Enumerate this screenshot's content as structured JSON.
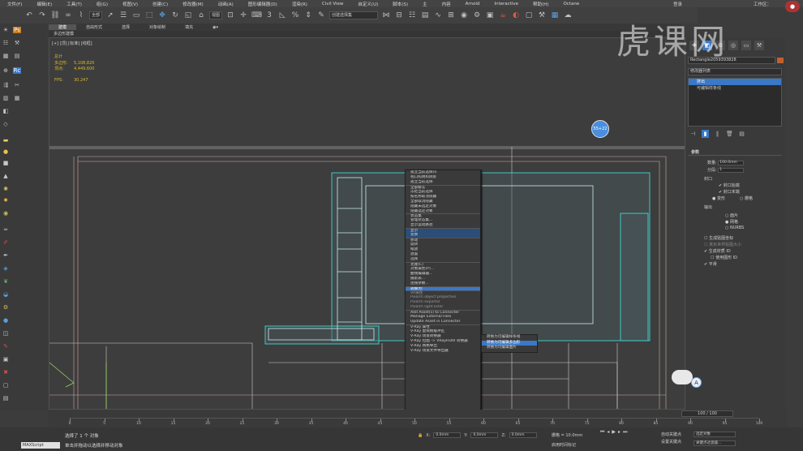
{
  "menu": [
    "文件(F)",
    "编辑(E)",
    "工具(T)",
    "组(G)",
    "视图(V)",
    "创建(C)",
    "修改器(M)",
    "动画(A)",
    "图形编辑器(D)",
    "渲染(R)",
    "Civil View",
    "自定义(U)",
    "脚本(S)",
    "主",
    "内容",
    "Arnold",
    "Interactive",
    "帮助(H)",
    "Octane"
  ],
  "login": "登录",
  "workspace": "工作区：",
  "toolbar": {
    "filter_select": "全部",
    "view_select": "视图",
    "selset_select": "创建选择集"
  },
  "ribbon": {
    "tabs": [
      "建模",
      "自由形式",
      "选择",
      "对象绘制",
      "填充"
    ],
    "sub": "多边形建模"
  },
  "viewport": {
    "label": "[+] [顶] [标准] [线框]",
    "stats": {
      "total_label": "总计",
      "poly_label": "多边形:",
      "poly_value": "5,108,820",
      "vert_label": "顶点:",
      "vert_value": "4,449,600",
      "fps_label": "FPS:",
      "fps_value": "30.247"
    },
    "badge": "55+22"
  },
  "context_menu": {
    "items": [
      "孤立当前选择(I)",
      "视口照明和阴影",
      "孤立当前选择",
      "全部解冻",
      "冻结当前选择",
      "按名称取消隐藏",
      "全部取消隐藏",
      "隐藏未选定对象",
      "隐藏选定对象",
      "状态集",
      "管理状态集...",
      "显示运动路径",
      "显示",
      "变换",
      "移动",
      "旋转",
      "缩放",
      "放置",
      "选择",
      "克隆(C)",
      "对象属性(P)...",
      "曲线编辑器...",
      "摄影表...",
      "连线参数...",
      "转换为:",
      "VR属性",
      "Pixarm object properties",
      "Pixarm exporter",
      "Pixarm light lister",
      "Add Asset(s) to Connecter",
      "Manage External Files",
      "Update Asset in Connecter",
      "V-Ray 属性",
      "V-Ray 虚拟帧缓冲区",
      "V-Ray 场景转换器",
      "V-Ray 位图 -> VRayHDRI 转换器",
      "V-Ray 网格导出",
      "V-Ray 场景文件导出器"
    ],
    "right_labels": [
      "显示",
      "变换"
    ],
    "selected": "转换为:"
  },
  "submenu": {
    "items": [
      "转换为可编辑样条线",
      "转换为可编辑多边形",
      "转换为可编辑面片"
    ],
    "selected": "转换为可编辑多边形"
  },
  "command_panel": {
    "object_name": "Rectangle2059393828",
    "object_color": "#c06030",
    "modifier_list": "修改器列表",
    "stack": [
      "挤出",
      "可编辑样条线"
    ],
    "stack_selected": "挤出",
    "params": {
      "title": "参数",
      "amount_label": "数量:",
      "amount_value": "100.0mm",
      "segments_label": "分段:",
      "segments_value": "1",
      "capping_label": "封口",
      "cap_start": "封口始端",
      "cap_end": "封口末端",
      "morph": "变形",
      "grid": "栅格",
      "output_label": "输出",
      "patch": "面片",
      "mesh": "网格",
      "nurbs": "NURBS",
      "gen_map": "生成贴图坐标",
      "real_world": "真实世界贴图大小",
      "gen_mat": "生成材质 ID",
      "use_shape": "使用图形 ID",
      "smooth": "平滑"
    }
  },
  "timeline": {
    "slider": "100 / 100",
    "ticks": [
      "0",
      "5",
      "10",
      "15",
      "20",
      "25",
      "30",
      "35",
      "40",
      "45",
      "50",
      "55",
      "60",
      "65",
      "70",
      "75",
      "80",
      "85",
      "90",
      "95",
      "100"
    ]
  },
  "status": {
    "maxscript": "MAXScript",
    "line1": "选择了 1 个 对象",
    "line2": "单击并拖动以选择并移动对象",
    "x_label": "X:",
    "x_value": "0.0mm",
    "y_label": "Y:",
    "y_value": "0.0mm",
    "z_label": "Z:",
    "z_value": "0.0mm",
    "grid": "栅格 = 10.0mm",
    "add_time": "启用时间标记",
    "auto_key": "自动关键点",
    "set_key": "设置关键点",
    "selected_set": "选定对象",
    "key_filters": "关键点过滤器...",
    "frame": "100"
  },
  "watermark": "虎课网"
}
